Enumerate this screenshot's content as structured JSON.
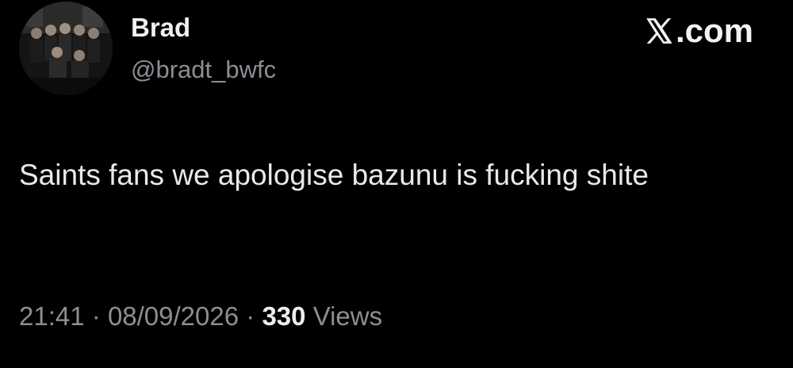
{
  "author": {
    "display_name": "Brad",
    "handle": "@bradt_bwfc"
  },
  "brand": {
    "label": ".com",
    "icon": "x-logo-icon"
  },
  "tweet": {
    "text": "Saints fans we apologise bazunu is fucking shite"
  },
  "meta": {
    "time": "21:41",
    "separator": "·",
    "date": "08/09/2026",
    "views_count": "330",
    "views_label": "Views"
  },
  "colors": {
    "background": "#000000",
    "text_primary": "#e7e9ea",
    "text_secondary": "#8b8f94"
  }
}
